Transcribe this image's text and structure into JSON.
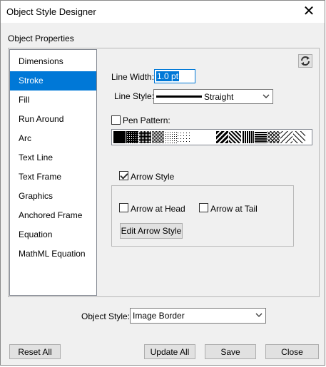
{
  "window": {
    "title": "Object Style Designer",
    "close_icon": "close-icon"
  },
  "group_label": "Object Properties",
  "sidebar": {
    "items": [
      {
        "label": "Dimensions"
      },
      {
        "label": "Stroke",
        "selected": true
      },
      {
        "label": "Fill"
      },
      {
        "label": "Run Around"
      },
      {
        "label": "Arc"
      },
      {
        "label": "Text Line"
      },
      {
        "label": "Text Frame"
      },
      {
        "label": "Graphics"
      },
      {
        "label": "Anchored Frame"
      },
      {
        "label": "Equation"
      },
      {
        "label": "MathML Equation"
      }
    ]
  },
  "stroke": {
    "line_width_label": "Line Width:",
    "line_width_value": "1.0 pt",
    "line_style_label": "Line Style:",
    "line_style_value": "Straight",
    "pen_pattern_label": "Pen Pattern:",
    "pen_pattern_checked": false,
    "arrow_style_label": "Arrow Style",
    "arrow_style_checked": true,
    "arrow_at_head_label": "Arrow at Head",
    "arrow_at_head_checked": false,
    "arrow_at_tail_label": "Arrow at Tail",
    "arrow_at_tail_checked": false,
    "edit_arrow_style_label": "Edit Arrow Style",
    "refresh_icon": "refresh-icon"
  },
  "object_style": {
    "label": "Object Style:",
    "value": "Image Border"
  },
  "footer": {
    "reset_all": "Reset All",
    "update_all": "Update All",
    "save": "Save",
    "close": "Close"
  },
  "colors": {
    "selection": "#0078d7",
    "dialog_bg": "#f0f0f0"
  }
}
